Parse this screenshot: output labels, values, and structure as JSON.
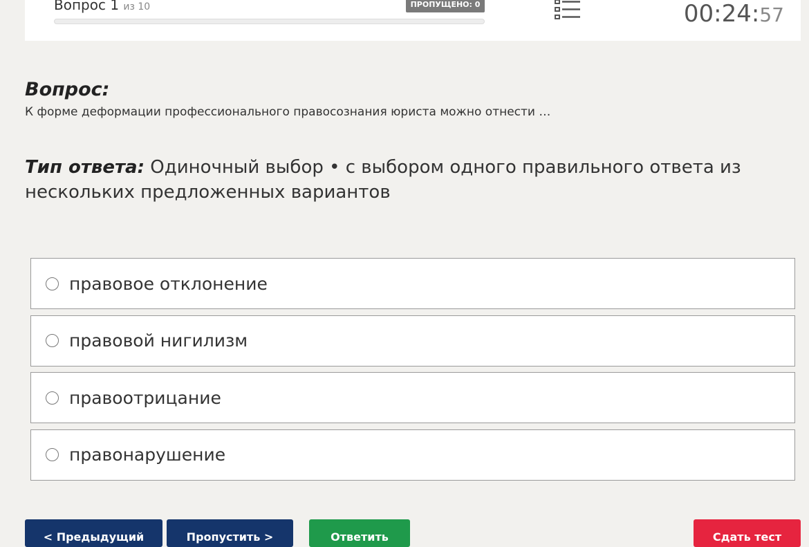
{
  "header": {
    "question_label": "Вопрос 1",
    "question_of": "из 10",
    "progress_fraction": 0.1,
    "skipped_badge": "ПРОПУЩЕНО: 0",
    "list_icon": "list-icon",
    "timer_main": "00:24:",
    "timer_seconds": "57"
  },
  "question": {
    "heading": "Вопрос:",
    "text": "К форме деформации профессионального правосознания юриста можно отнести …"
  },
  "answer_type": {
    "label": "Тип ответа:",
    "value": " Одиночный выбор • с выбором одного правильного ответа из нескольких предложенных вариантов"
  },
  "options": [
    {
      "label": "правовое отклонение"
    },
    {
      "label": "правовой нигилизм"
    },
    {
      "label": "правоотрицание"
    },
    {
      "label": "правонарушение"
    }
  ],
  "buttons": {
    "prev": "< Предыдущий",
    "skip": "Пропустить >",
    "answer": "Ответить",
    "finish": "Сдать тест"
  },
  "colors": {
    "nav_button": "#15356b",
    "answer_button": "#1f9a4b",
    "finish_button": "#e6243f"
  }
}
